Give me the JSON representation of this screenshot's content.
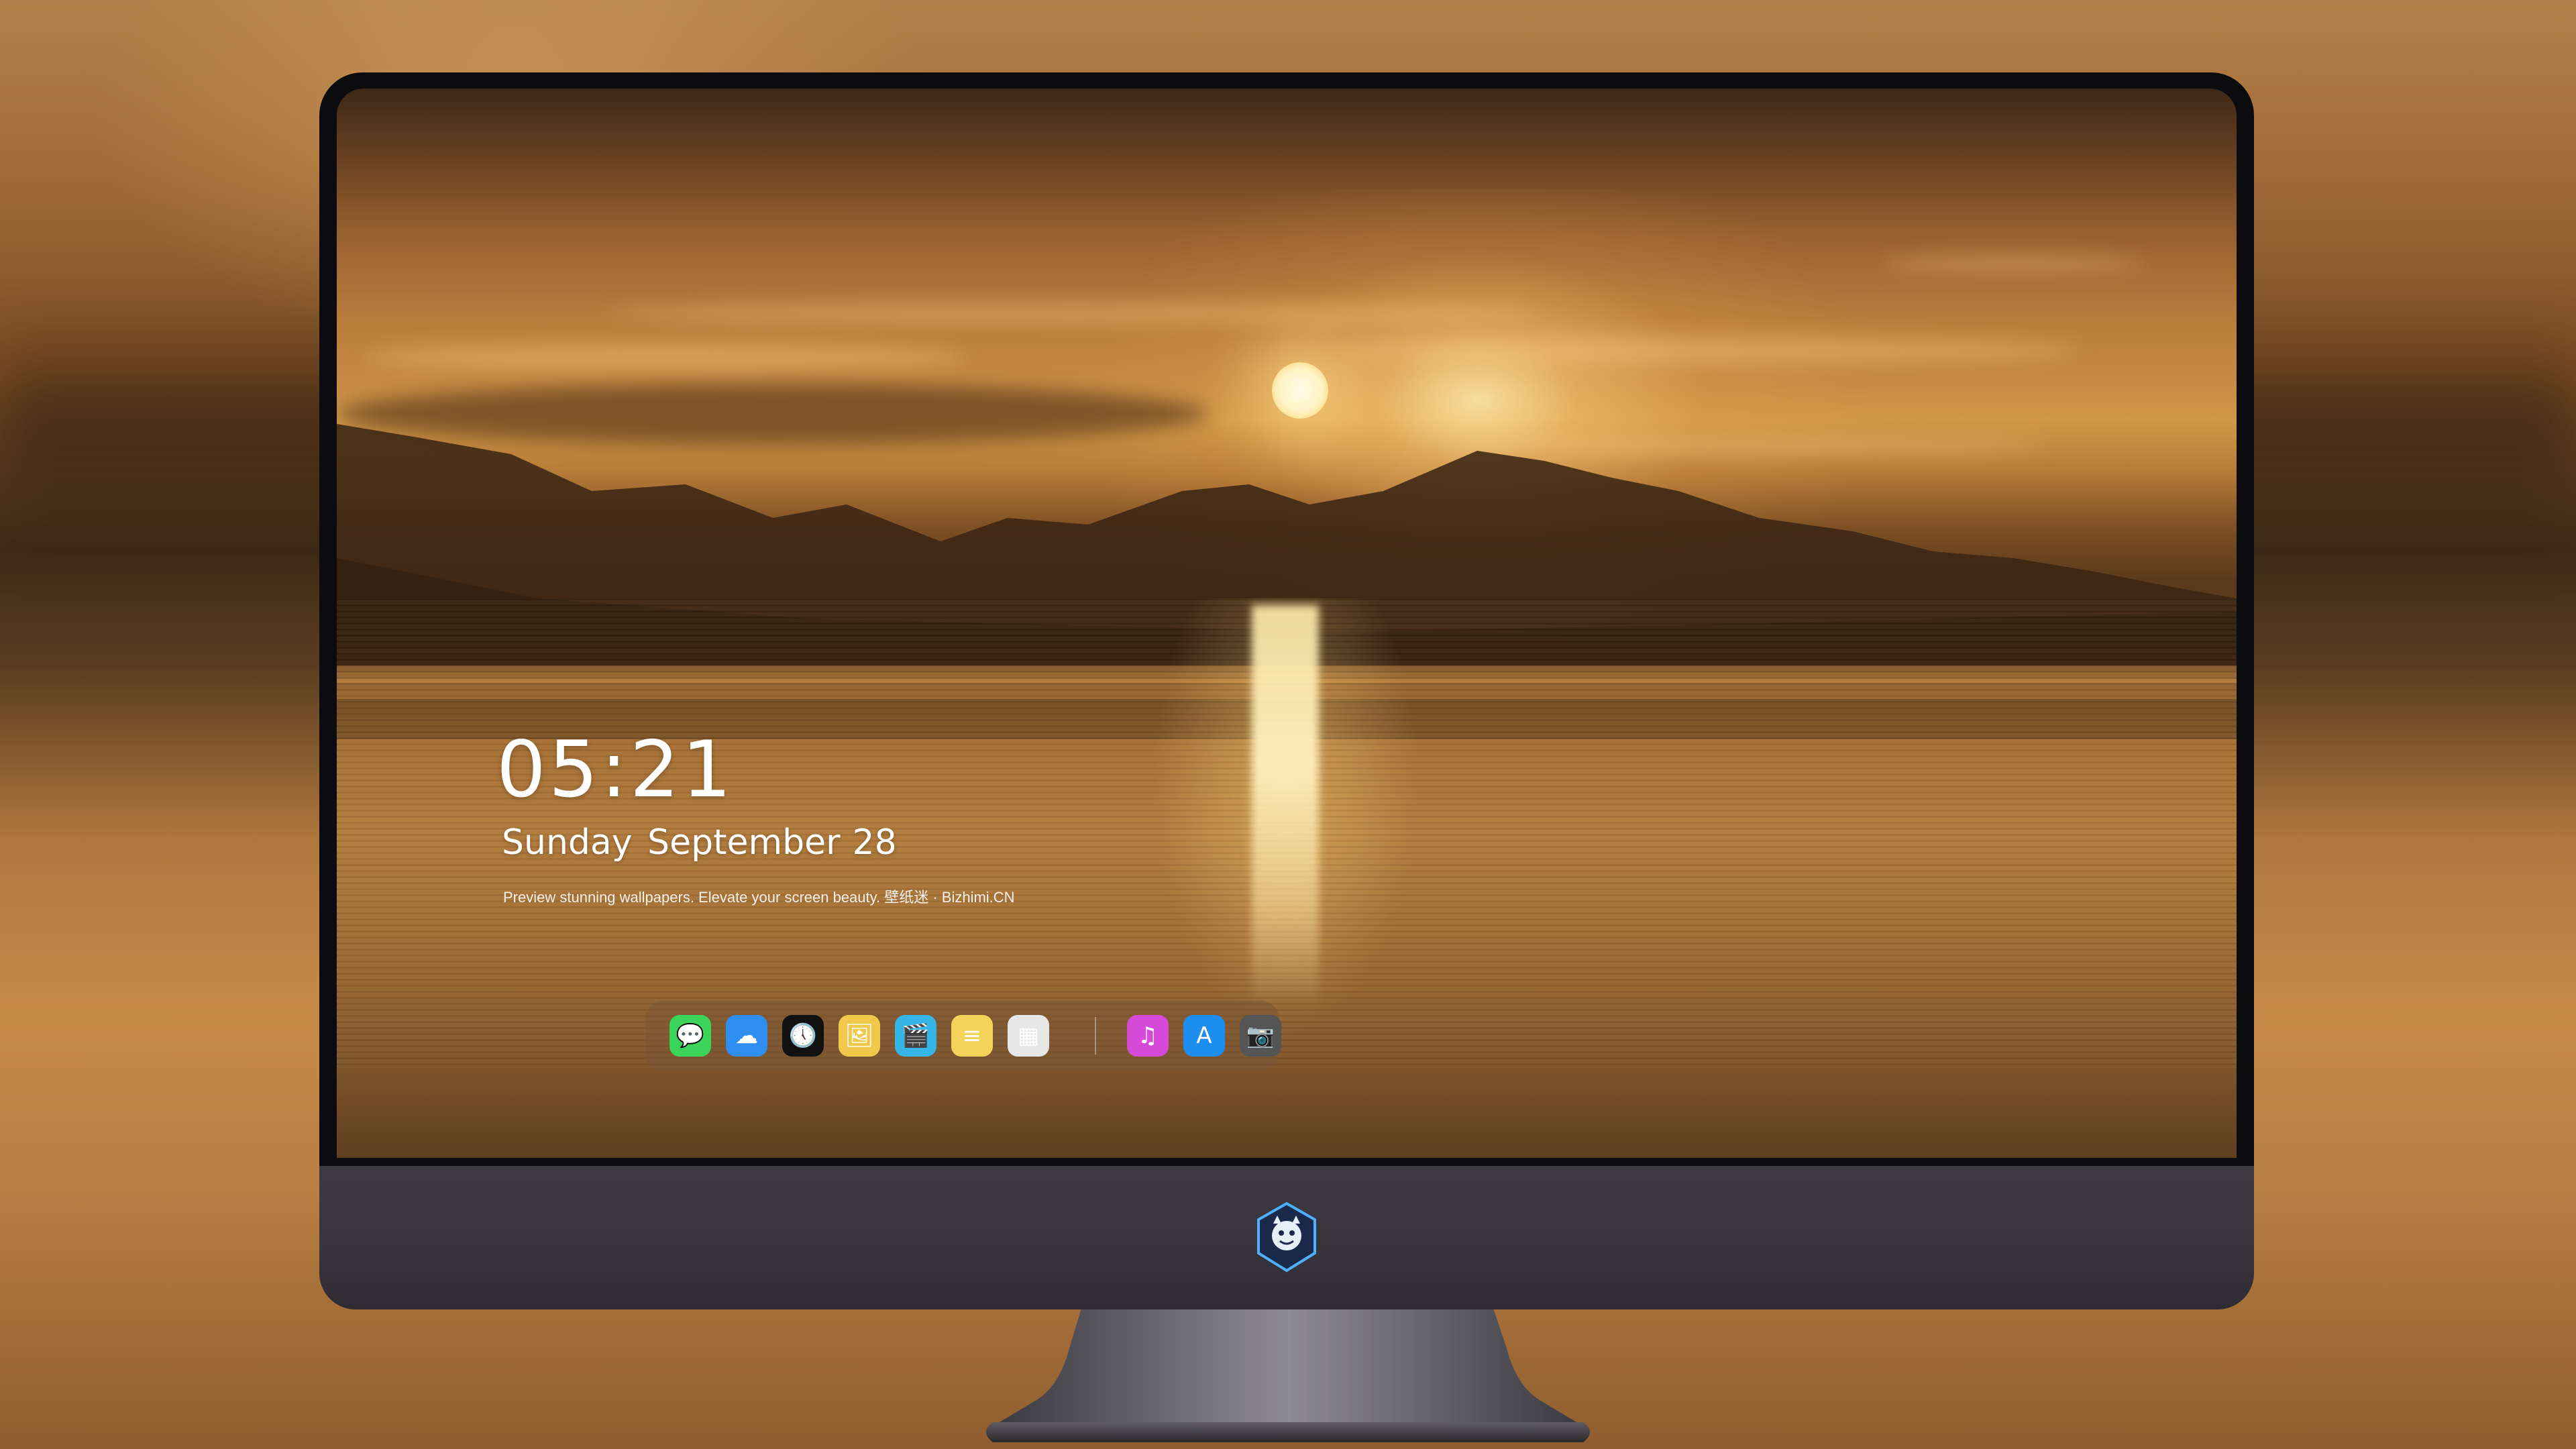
{
  "lock_screen": {
    "time": "05:21",
    "weekday_month": "Sunday September",
    "day": "28",
    "tagline": "Preview stunning wallpapers. Elevate your screen beauty. 壁纸迷 · Bizhimi.CN"
  },
  "dock": {
    "apps": [
      {
        "name": "messages-icon",
        "glyph": "💬",
        "color": "#3bd35a"
      },
      {
        "name": "weather-icon",
        "glyph": "☁",
        "color": "#2f8ef0"
      },
      {
        "name": "clock-icon",
        "glyph": "🕔",
        "color": "#111111"
      },
      {
        "name": "preview-icon",
        "glyph": "🖼",
        "color": "#f1c94a"
      },
      {
        "name": "final-cut-icon",
        "glyph": "🎬",
        "color": "#36b6e6"
      },
      {
        "name": "notes-icon",
        "glyph": "≡",
        "color": "#f5d35a"
      },
      {
        "name": "photo-booth-icon",
        "glyph": "▦",
        "color": "#e7e7e7"
      },
      {
        "name": "itunes-icon",
        "glyph": "♫",
        "color": "#d54ad8"
      },
      {
        "name": "app-store-icon",
        "glyph": "A",
        "color": "#1e8df0"
      },
      {
        "name": "camera-icon",
        "glyph": "📷",
        "color": "#555555"
      }
    ]
  },
  "colors": {
    "bezel": "#0c0c0e",
    "chin": "#3a3740",
    "accent_sun": "#fff3c4"
  }
}
